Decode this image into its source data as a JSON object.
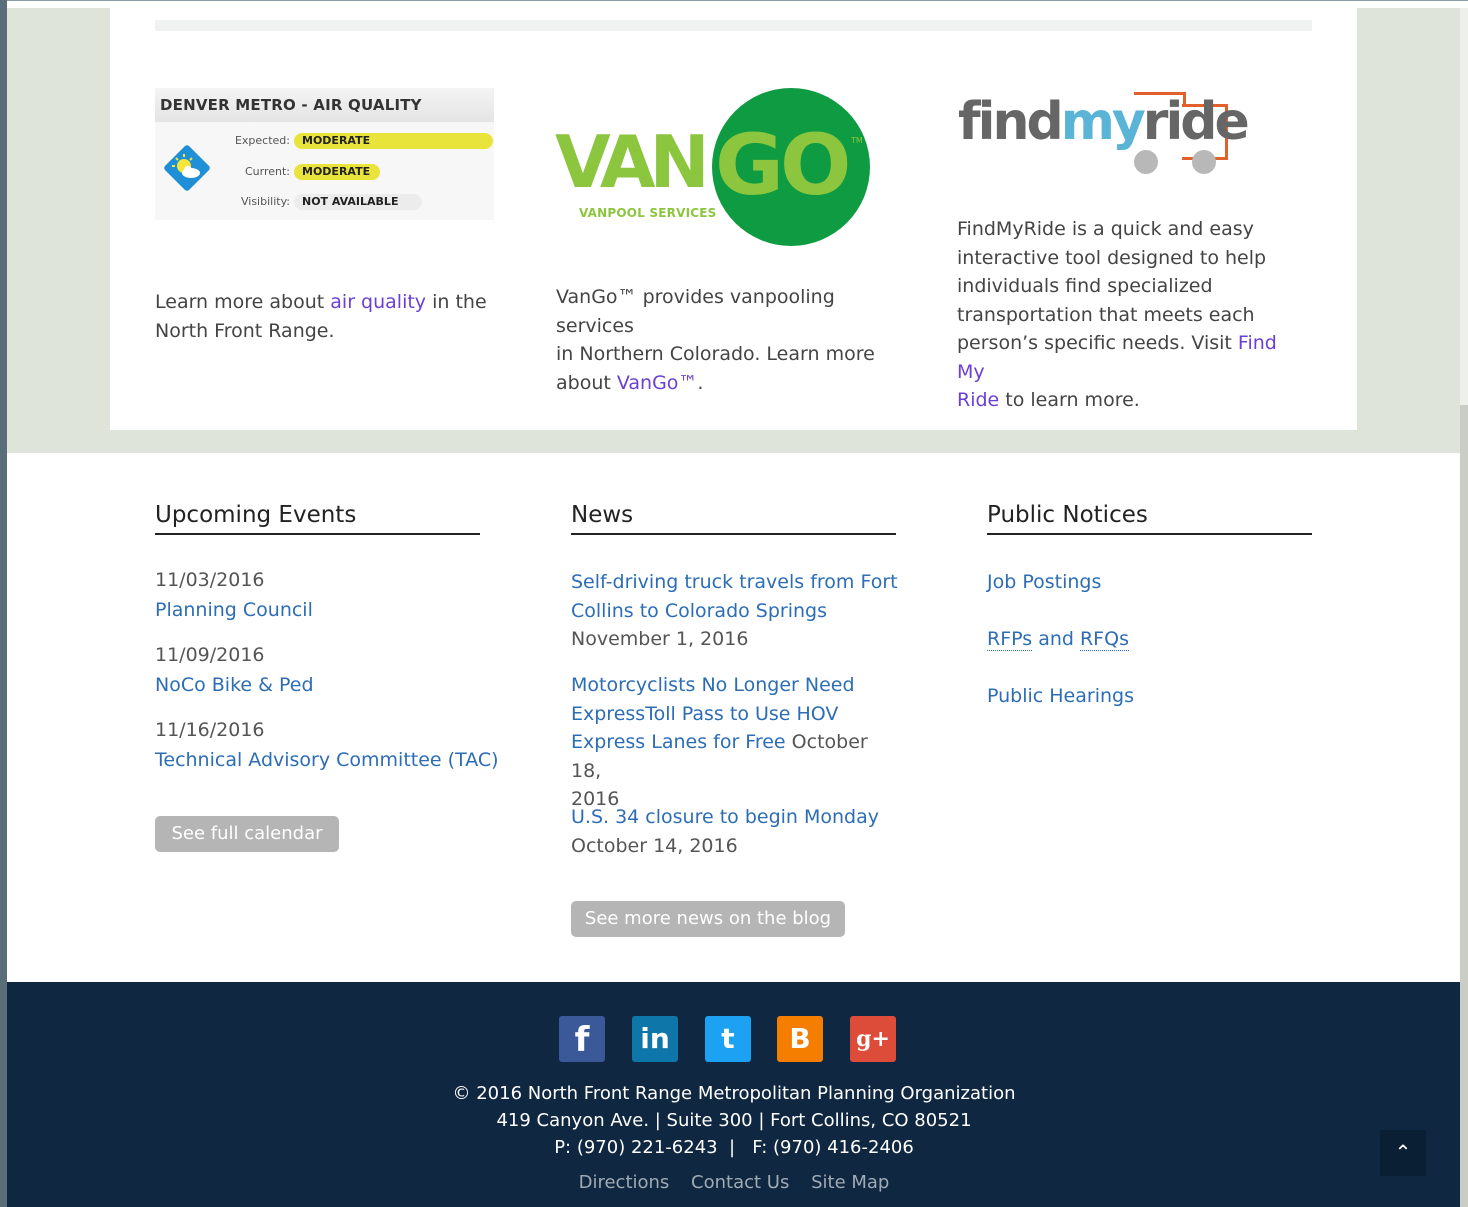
{
  "air_quality": {
    "title": "DENVER METRO - AIR QUALITY",
    "expected_label": "Expected:",
    "expected_value": "MODERATE",
    "current_label": "Current:",
    "current_value": "MODERATE",
    "visibility_label": "Visibility:",
    "visibility_value": "NOT AVAILABLE",
    "text_before": "Learn more about ",
    "link": "air quality",
    "text_after_1": " in the",
    "text_after_2": "North Front Range."
  },
  "vango": {
    "logo_van": "VAN",
    "logo_go": "GO",
    "logo_tm": "TM",
    "logo_sub": "VANPOOL SERVICES",
    "line1": "VanGo™ provides vanpooling services",
    "line2": "in Northern Colorado. Learn more",
    "line3_before": "about ",
    "link": "VanGo™",
    "line3_after": "."
  },
  "findmyride": {
    "logo_find": "find",
    "logo_my": "my",
    "logo_ride": "ride",
    "line1": "FindMyRide is a quick and easy",
    "line2": "interactive tool designed to help",
    "line3": "individuals find specialized",
    "line4": "transportation that meets each",
    "line5_before": "person’s specific needs. Visit ",
    "link_part1": "Find My",
    "link_part2": "Ride",
    "line6_after": " to learn more."
  },
  "events": {
    "heading": "Upcoming Events",
    "items": [
      {
        "date": "11/03/2016",
        "title": "Planning Council"
      },
      {
        "date": "11/09/2016",
        "title": "NoCo Bike & Ped"
      },
      {
        "date": "11/16/2016",
        "title": "Technical Advisory Committee (TAC)"
      }
    ],
    "button": "See full calendar"
  },
  "news": {
    "heading": "News",
    "items": [
      {
        "title_1": "Self-driving truck travels from Fort",
        "title_2": "Collins to Colorado Springs",
        "date": "November 1, 2016"
      },
      {
        "title_1": "Motorcyclists No Longer Need",
        "title_2": "ExpressToll Pass to Use HOV",
        "title_3": "Express Lanes for Free",
        "date_1": " October 18,",
        "date_2": "2016"
      },
      {
        "title_1": "U.S. 34 closure to begin Monday",
        "date": "October 14, 2016"
      }
    ],
    "button": "See more news on the blog"
  },
  "notices": {
    "heading": "Public Notices",
    "job": "Job Postings",
    "rfps": "RFPs",
    "and": " and ",
    "rfqs": "RFQs",
    "hearings": "Public Hearings"
  },
  "footer": {
    "social": {
      "facebook": "f",
      "linkedin": "in",
      "twitter": "t",
      "blogger": "B",
      "googleplus": "g+"
    },
    "colors": {
      "facebook": "#3b5998",
      "linkedin": "#0e76a8",
      "twitter": "#1da1f2",
      "blogger": "#f57d00",
      "googleplus": "#dd4b39"
    },
    "copyright": "© 2016 North Front Range Metropolitan Planning Organization",
    "address": "419 Canyon Ave. | Suite 300 | Fort Collins, CO 80521",
    "phone": "P: (970) 221-6243  |   F: (970) 416-2406",
    "links": [
      "Directions",
      "Contact Us",
      "Site Map"
    ],
    "back_to_top": "⌃"
  }
}
